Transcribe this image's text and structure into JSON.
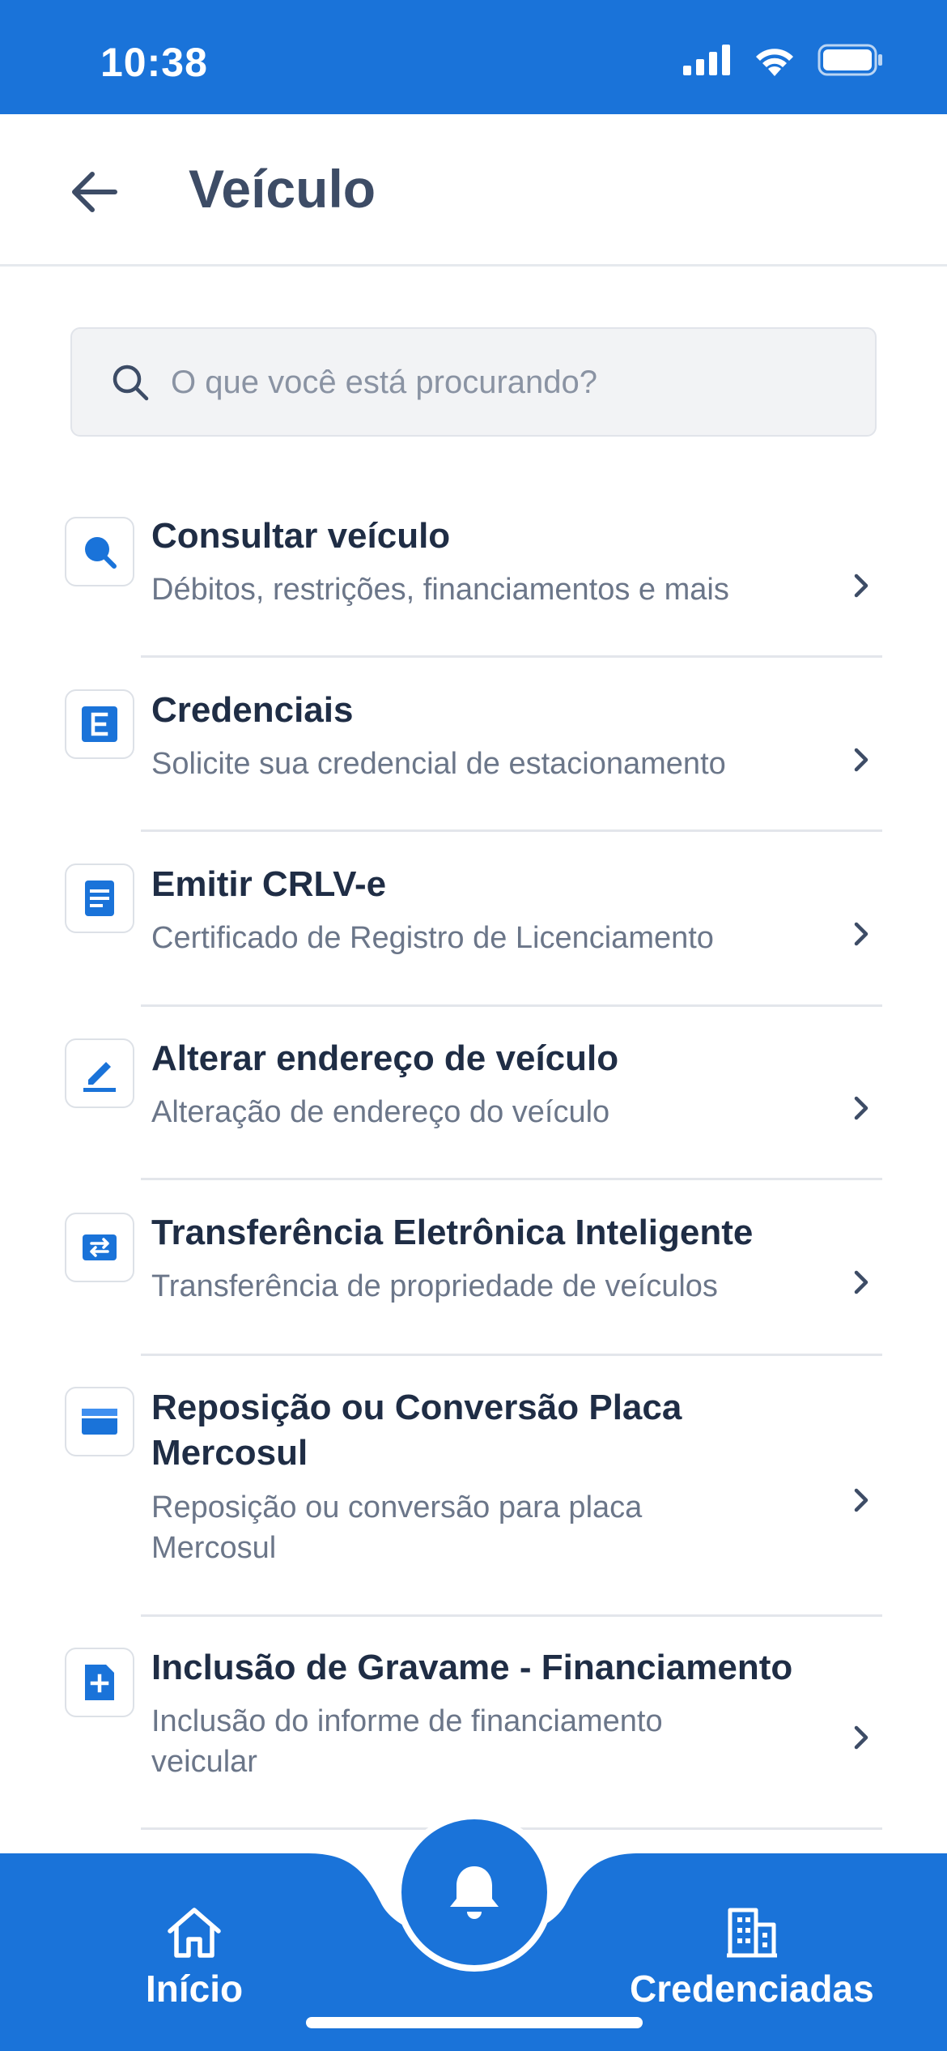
{
  "status_bar": {
    "time": "10:38"
  },
  "header": {
    "title": "Veículo"
  },
  "search": {
    "placeholder": "O que você está procurando?"
  },
  "items": [
    {
      "title": "Consultar veículo",
      "subtitle": "Débitos, restrições, financiamentos e mais",
      "icon": "search-icon"
    },
    {
      "title": "Credenciais",
      "subtitle": "Solicite sua credencial de estacionamento",
      "icon": "e-badge-icon"
    },
    {
      "title": "Emitir CRLV-e",
      "subtitle": "Certificado de Registro de Licenciamento",
      "icon": "document-icon"
    },
    {
      "title": "Alterar endereço de veículo",
      "subtitle": "Alteração de endereço do veículo",
      "icon": "edit-icon"
    },
    {
      "title": "Transferência Eletrônica Inteligente",
      "subtitle": "Transferência de propriedade de veículos",
      "icon": "transfer-icon"
    },
    {
      "title": "Reposição ou Conversão Placa Mercosul",
      "subtitle": "Reposição ou conversão para placa Mercosul",
      "icon": "plate-icon"
    },
    {
      "title": "Inclusão de Gravame - Financiamento",
      "subtitle": "Inclusão do informe de financiamento veicular",
      "icon": "add-document-icon"
    }
  ],
  "bottom_nav": {
    "home_label": "Início",
    "accredited_label": "Credenciadas"
  },
  "colors": {
    "primary": "#1a73d9",
    "title": "#1f2d45",
    "subtitle": "#6b7689"
  }
}
